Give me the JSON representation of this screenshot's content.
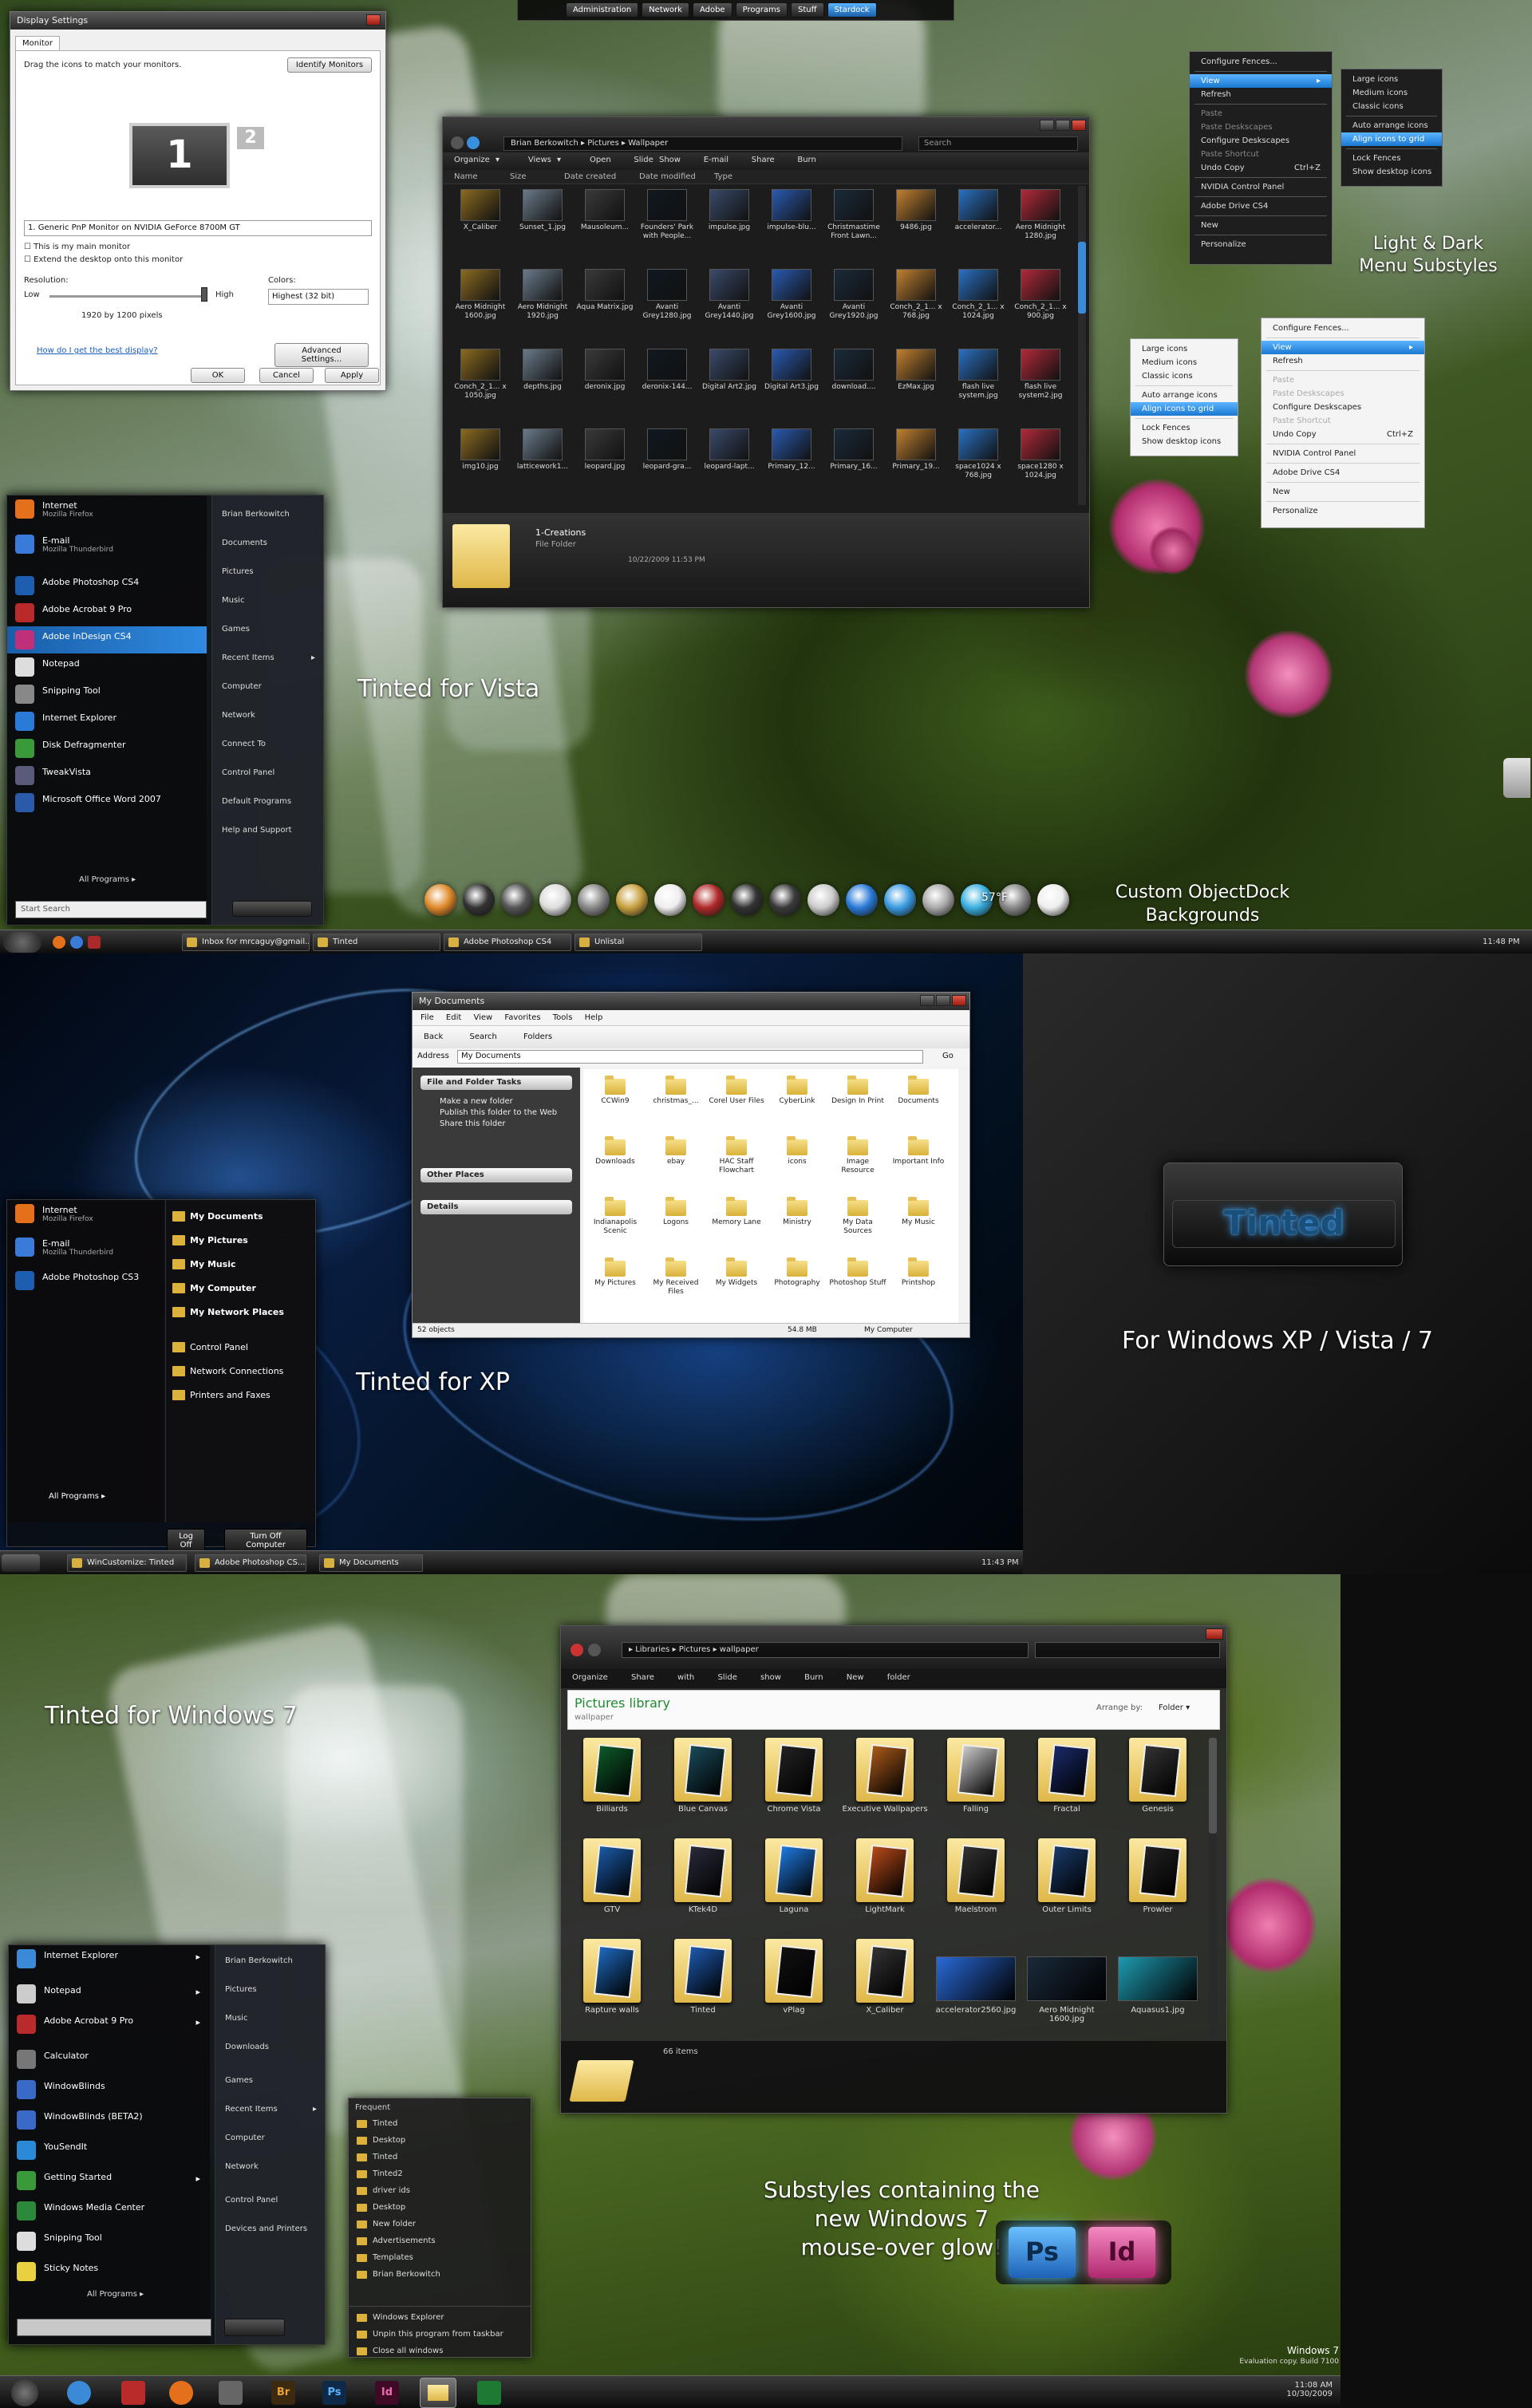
{
  "vista": {
    "menubar": [
      "Administration",
      "Network",
      "Adobe",
      "Programs",
      "Stuff",
      "Stardock"
    ],
    "display": {
      "title": "Display Settings",
      "tab": "Monitor",
      "hint": "Drag the icons to match your monitors.",
      "identify": "Identify Monitors",
      "mon1": "1",
      "mon2": "2",
      "monitor_select": "1. Generic PnP Monitor on NVIDIA GeForce 8700M GT",
      "chk_main": "This is my main monitor",
      "chk_extend": "Extend the desktop onto this monitor",
      "res_label": "Resolution:",
      "low": "Low",
      "high": "High",
      "res_value": "1920 by 1200 pixels",
      "colors_label": "Colors:",
      "colors_value": "Highest (32 bit)",
      "help_link": "How do I get the best display?",
      "advanced": "Advanced Settings...",
      "ok": "OK",
      "cancel": "Cancel",
      "apply": "Apply"
    },
    "explorer": {
      "crumbs": [
        "Brian Berkowitch",
        "Pictures",
        "Wallpaper"
      ],
      "search": "Search",
      "toolbar": [
        "Organize",
        "Views",
        "Open",
        "Slide Show",
        "E-mail",
        "Share",
        "Burn"
      ],
      "columns": [
        "Name",
        "Size",
        "Date created",
        "Date modified",
        "Type"
      ],
      "files": [
        "X_Caliber",
        "Sunset_1.jpg",
        "Mausoleum...",
        "Founders' Park with People...",
        "impulse.jpg",
        "impulse-blu...",
        "Christmastime Front Lawn...",
        "9486.jpg",
        "accelerator...",
        "Aero Midnight 1280.jpg",
        "Aero Midnight 1600.jpg",
        "Aero Midnight 1920.jpg",
        "Aqua Matrix.jpg",
        "Avanti Grey1280.jpg",
        "Avanti Grey1440.jpg",
        "Avanti Grey1600.jpg",
        "Avanti Grey1920.jpg",
        "Conch_2_1... x 768.jpg",
        "Conch_2_1... x 1024.jpg",
        "Conch_2_1... x 900.jpg",
        "Conch_2_1... x 1050.jpg",
        "depths.jpg",
        "deronix.jpg",
        "deronix-144...",
        "Digital Art2.jpg",
        "Digital Art3.jpg",
        "download....",
        "EzMax.jpg",
        "flash live system.jpg",
        "flash live system2.jpg",
        "img10.jpg",
        "latticework1...",
        "leopard.jpg",
        "leopard-gra...",
        "leopard-lapt...",
        "Primary_12...",
        "Primary_16...",
        "Primary_19...",
        "space1024 x 768.jpg",
        "space1280 x 1024.jpg"
      ],
      "preview_name": "1-Creations",
      "preview_type": "File Folder",
      "preview_date": "10/22/2009 11:53 PM"
    },
    "ctx_dark": {
      "top": "Configure Fences...",
      "items": [
        "View",
        "Refresh",
        "Paste",
        "Paste Deskscapes",
        "Configure Deskscapes",
        "Paste Shortcut",
        "Undo Copy",
        "NVIDIA Control Panel",
        "Adobe Drive CS4",
        "New",
        "Personalize"
      ],
      "undo_key": "Ctrl+Z"
    },
    "sub_dark": [
      "Large icons",
      "Medium icons",
      "Classic icons",
      "Auto arrange icons",
      "Align icons to grid",
      "Lock Fences",
      "Show desktop icons"
    ],
    "sub_light": [
      "Large icons",
      "Medium icons",
      "Classic icons",
      "Auto arrange icons",
      "Align icons to grid",
      "Lock Fences",
      "Show desktop icons"
    ],
    "ctx_light": {
      "top": "Configure Fences...",
      "items": [
        "View",
        "Refresh",
        "Paste",
        "Paste Deskscapes",
        "Configure Deskscapes",
        "Paste Shortcut",
        "Undo Copy",
        "NVIDIA Control Panel",
        "Adobe Drive CS4",
        "New",
        "Personalize"
      ],
      "undo_key": "Ctrl+Z"
    },
    "menus_caption": "Light & Dark\nMenu Substyles",
    "startmenu": {
      "pinned": [
        {
          "t": "Internet",
          "s": "Mozilla Firefox"
        },
        {
          "t": "E-mail",
          "s": "Mozilla Thunderbird"
        }
      ],
      "recent": [
        "Adobe Photoshop CS4",
        "Adobe Acrobat 9 Pro",
        "Adobe InDesign CS4",
        "Notepad",
        "Snipping Tool",
        "Internet Explorer",
        "Disk Defragmenter",
        "TweakVista",
        "Microsoft Office Word 2007"
      ],
      "all": "All Programs",
      "search": "Start Search",
      "right": [
        "Brian Berkowitch",
        "Documents",
        "Pictures",
        "Music",
        "Games",
        "Recent Items",
        "Computer",
        "Network",
        "Connect To",
        "Control Panel",
        "Default Programs",
        "Help and Support"
      ]
    },
    "tinted_caption": "Tinted for Vista",
    "dock_temp": "57°F",
    "dock_caption": "Custom ObjectDock\nBackgrounds",
    "taskbar": {
      "tasks": [
        "Inbox for mrcaguy@gmail...",
        "Tinted",
        "Adobe Photoshop CS4",
        "Unlistal"
      ],
      "clock": "11:48 PM"
    }
  },
  "xp": {
    "explorer": {
      "title": "My Documents",
      "menu": [
        "File",
        "Edit",
        "View",
        "Favorites",
        "Tools",
        "Help"
      ],
      "toolbar": [
        "Back",
        "Search",
        "Folders"
      ],
      "address_label": "Address",
      "address": "My Documents",
      "go": "Go",
      "tasks_title": "File and Folder Tasks",
      "tasks": [
        "Make a new folder",
        "Publish this folder to the Web",
        "Share this folder"
      ],
      "other": "Other Places",
      "details": "Details",
      "items": [
        "CCWin9",
        "christmas_...",
        "Corel User Files",
        "CyberLink",
        "Design In Print",
        "Documents",
        "Downloads",
        "ebay",
        "HAC Staff Flowchart",
        "icons",
        "Image Resource",
        "Important Info",
        "Indianapolis Scenic",
        "Logons",
        "Memory Lane",
        "Ministry",
        "My Data Sources",
        "My Music",
        "My Pictures",
        "My Received Files",
        "My Widgets",
        "Photography",
        "Photoshop Stuff",
        "Printshop"
      ],
      "status_count": "52 objects",
      "status_size": "54.8 MB",
      "status_loc": "My Computer"
    },
    "startmenu": {
      "pinned": [
        {
          "t": "Internet",
          "s": "Mozilla Firefox"
        },
        {
          "t": "E-mail",
          "s": "Mozilla Thunderbird"
        },
        {
          "t": "Adobe Photoshop CS3",
          "s": ""
        }
      ],
      "right": [
        "My Documents",
        "My Pictures",
        "My Music",
        "My Computer",
        "My Network Places",
        "Control Panel",
        "Network Connections",
        "Printers and Faxes"
      ],
      "all": "All Programs",
      "logoff": "Log Off",
      "turnoff": "Turn Off Computer"
    },
    "caption": "Tinted for XP",
    "logo_text": "Tinted",
    "for_caption": "For Windows XP / Vista / 7",
    "taskbar": {
      "tasks": [
        "WinCustomize: Tinted",
        "Adobe Photoshop CS...",
        "My Documents"
      ],
      "clock": "11:43 PM"
    }
  },
  "w7": {
    "caption": "Tinted for Windows 7",
    "explorer": {
      "crumbs": [
        "Libraries",
        "Pictures",
        "wallpaper"
      ],
      "toolbar": [
        "Organize",
        "Share with",
        "Slide show",
        "Burn",
        "New folder"
      ],
      "lib_title": "Pictures library",
      "lib_sub": "wallpaper",
      "arrange_label": "Arrange by:",
      "arrange_value": "Folder",
      "items": [
        "Billiards",
        "Blue Canvas",
        "Chrome Vista",
        "Executive Wallpapers",
        "Falling",
        "Fractal",
        "Genesis",
        "GTV",
        "KTek4D",
        "Laguna",
        "LightMark",
        "Maelstrom",
        "Outer Limits",
        "Prowler",
        "Rapture walls",
        "Tinted",
        "vPlag",
        "X_Caliber",
        "accelerator2560.jpg",
        "Aero Midnight 1600.jpg",
        "Aquasus1.jpg"
      ],
      "count": "66 items"
    },
    "startmenu": {
      "left": [
        "Internet Explorer",
        "Notepad",
        "Adobe Acrobat 9 Pro",
        "Calculator",
        "WindowBlinds",
        "WindowBlinds (BETA2)",
        "YouSendIt",
        "Getting Started",
        "Windows Media Center",
        "Snipping Tool",
        "Sticky Notes"
      ],
      "right": [
        "Brian Berkowitch",
        "Pictures",
        "Music",
        "Downloads",
        "Games",
        "Recent Items",
        "Computer",
        "Network",
        "Control Panel",
        "Devices and Printers"
      ],
      "all": "All Programs"
    },
    "jumplist": {
      "title": "Frequent",
      "items": [
        "Tinted",
        "Desktop",
        "Tinted",
        "Tinted2",
        "driver ids",
        "Desktop",
        "New folder",
        "Advertisements",
        "Templates",
        "Brian Berkowitch"
      ],
      "actions": [
        "Windows Explorer",
        "Unpin this program from taskbar",
        "Close all windows"
      ]
    },
    "glow_caption": "Substyles containing the\nnew Windows 7\nmouse-over glow!",
    "ps": "Ps",
    "id": "Id",
    "taskbar": {
      "br": "Br",
      "ps": "Ps",
      "id": "Id"
    },
    "watermark": {
      "title": "Windows 7",
      "build": "Evaluation copy. Build 7100"
    },
    "clock": {
      "time": "11:08 AM",
      "date": "10/30/2009"
    }
  },
  "colors": {
    "accent": "#1a78d0",
    "ps_blue": "#2a7ad8",
    "id_pink": "#c4378a",
    "glow_blue": "#5cc4ff"
  }
}
